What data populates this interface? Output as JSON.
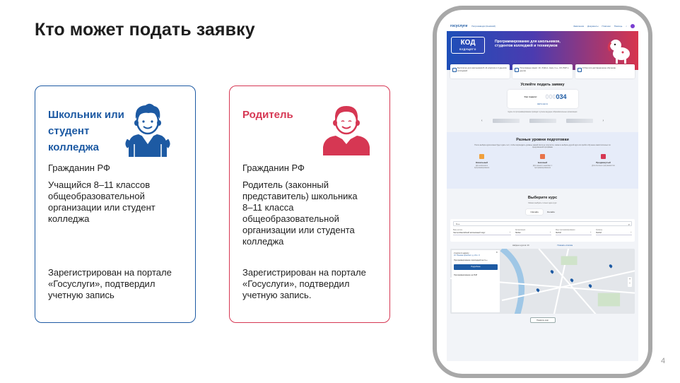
{
  "slide": {
    "title": "Кто может подать заявку",
    "page_number": "4"
  },
  "cards": {
    "student": {
      "title": "Школьник или студент колледжа",
      "line1": "Гражданин РФ",
      "line2": "Учащийся 8–11 классов общеобразовательной организации или студент колледжа",
      "line3": "Зарегистрирован на портале «Госуслуги», подтвердил учетную запись",
      "color": "#1d5aa3",
      "icon": "student-avatar-icon"
    },
    "parent": {
      "title": "Родитель",
      "line1": "Гражданин РФ",
      "line2": "Родитель (законный представитель) школьника 8–11 класса общеобразовательной организации или студента колледжа",
      "line3": "Зарегистрирован на портале «Госуслуги», подтвердил учетную запись.",
      "color": "#d63753",
      "icon": "parent-avatar-icon"
    }
  },
  "phone": {
    "nav": {
      "logo": "госуслуги",
      "region": "Петрозаводск (Кемский)",
      "links": [
        "Заявления",
        "Документы",
        "Платежи",
        "Помощь"
      ]
    },
    "banner": {
      "logo_main": "КОД",
      "logo_sub": "БУДУЩЕГО",
      "headline": "Программирование для школьников, студентов колледжей и техникумов"
    },
    "features": [
      "Бесплатно для школьников 8–11 классов и студентов колледжей",
      "Популярные языки: 1С, Python, Java, C++, C#, PHP и другие",
      "Отбор или дистанционное обучение"
    ],
    "apply": {
      "title": "Успейте подать заявку",
      "label": "Уже подали:",
      "counter_faded": "000",
      "counter": "034",
      "sub": "Найти место",
      "partners_caption": "Курсы по программированию проводят лучшие ведущие образовательные организации"
    },
    "levels": {
      "title": "Разные уровни подготовки",
      "desc": "После выбора курса можно будет сдать тест, чтобы подтвердить уровень знаний. Если не получится, сможете выбрать другой курс или пройти обучение самостоятельно по предложенной программе",
      "items": [
        {
          "name": "Начальный",
          "desc": "Для новичков в программировании",
          "color": "#f0a03c"
        },
        {
          "name": "Базовый",
          "desc": "Для немного знакомых с программированием",
          "color": "#e8744a"
        },
        {
          "name": "Продвинутый",
          "desc": "Для опытных программистов",
          "color": "#d63753"
        }
      ]
    },
    "course": {
      "title": "Выберите курс",
      "sub": "Можно выбрать только один курс",
      "tab_online": "Офлайн",
      "tab_other": "Онлайн",
      "search_value": "С++",
      "filters": [
        {
          "label": "Ваш регион",
          "value": "Ханты-Мансийский автономный округ"
        },
        {
          "label": "Организация",
          "value": "Любая"
        },
        {
          "label": "Язык программирования",
          "value": "Любой"
        },
        {
          "label": "Уровень",
          "value": "Любой"
        }
      ],
      "found": "Найдено курсов: 29",
      "show_list": "Показать списком",
      "map_panel_title": "2 курса по адресу",
      "map_panel_addr": "Ул. Ленина проспект, д. 21 к. 3",
      "map_panel_course": "Программирование прикладной на С++",
      "map_panel_btn": "Подробнее",
      "map_panel_next": "Программирование на PHP",
      "more_button": "Показать ещё"
    }
  }
}
